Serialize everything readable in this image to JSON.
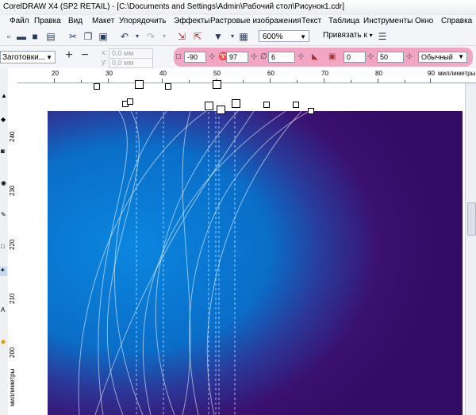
{
  "window": {
    "title": "CorelDRAW X4 (SP2 RETAIL) - [C:\\Documents and Settings\\Admin\\Рабочий стол\\Рисунок1.cdr]"
  },
  "menu": [
    "Файл",
    "Правка",
    "Вид",
    "Макет",
    "Упорядочить",
    "Эффекты",
    "Растровые изображения",
    "Текст",
    "Таблица",
    "Инструменты",
    "Окно",
    "Справка"
  ],
  "toolbar": {
    "zoom": "600%",
    "snap": "Привязать к"
  },
  "propbar": {
    "preset": "Заготовки...",
    "x": "0,0 мм",
    "y": "0,0 мм",
    "angle": "-90",
    "speed": "97",
    "width_val": "6",
    "offset": "0",
    "rate": "50",
    "blend": "Обычный"
  },
  "ruler": {
    "h_labels": [
      "20",
      "30",
      "40",
      "50",
      "60",
      "70",
      "80",
      "90"
    ],
    "units": "миллиметры",
    "v_labels": [
      "240",
      "230",
      "220",
      "210",
      "200"
    ],
    "v_units": "миллиметры"
  },
  "colors": {
    "accent_highlight": "#f2a6c4",
    "art_blue": "#0a6ec8",
    "art_purple": "#3a1070"
  }
}
